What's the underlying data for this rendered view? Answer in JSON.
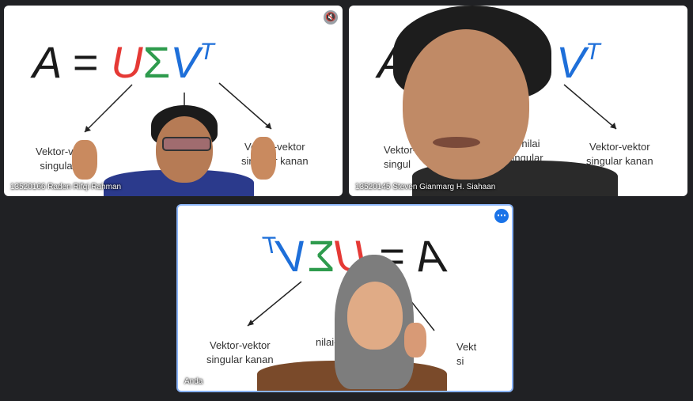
{
  "tiles": [
    {
      "participant": "13520166 Raden Rifqi Rahman",
      "slide": {
        "equation": {
          "a": "A",
          "eq": "=",
          "u": "U",
          "sigma": "Σ",
          "v": "V",
          "t": "T"
        },
        "left_label_1": "Vektor-vektor",
        "left_label_2": "singular kiri",
        "right_label_1": "Vektor-vektor",
        "right_label_2": "singular kanan"
      },
      "mic_icon": "mic-off-icon"
    },
    {
      "participant": "13520145 Steven Gianmarg H. Siahaan",
      "slide": {
        "equation": {
          "a": "A",
          "v": "V",
          "t": "T"
        },
        "left_label_1": "Vektor-",
        "left_label_2": "singul",
        "mid_label_1": "ai-nilai",
        "mid_label_2": "singular",
        "right_label_1": "Vektor-vektor",
        "right_label_2": "singular kanan"
      }
    },
    {
      "participant": "Anda",
      "slide": {
        "equation": {
          "a": "A",
          "eq": "=",
          "u": "U",
          "sigma": "Σ",
          "v": "V",
          "t": "T"
        },
        "left_label_1": "Vektor-vektor",
        "left_label_2": "singular kanan",
        "mid_label": "nilai-nilai",
        "right_label_1": "Vekt",
        "right_label_2": "si"
      },
      "menu_icon": "more-options-icon"
    }
  ],
  "colors": {
    "background": "#202124",
    "u": "#e53935",
    "sigma": "#2e9b4d",
    "v": "#1e6fd9",
    "active_border": "#8ab4f8"
  }
}
